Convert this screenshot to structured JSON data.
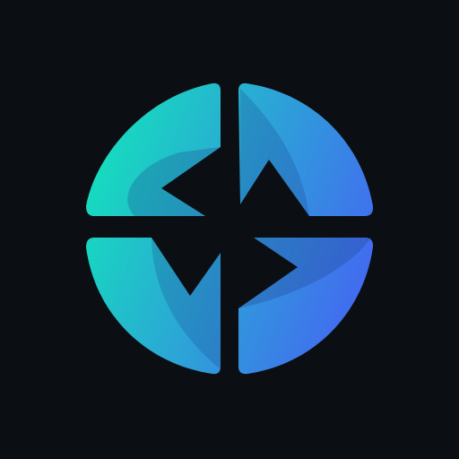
{
  "logo": {
    "icon": "circular-quadrant-arrows-logo",
    "background_color": "#0b0e12",
    "gradient": {
      "start_color": "#16dcbe",
      "end_color": "#4466f2"
    },
    "shade_color": "#1d3f8a"
  }
}
